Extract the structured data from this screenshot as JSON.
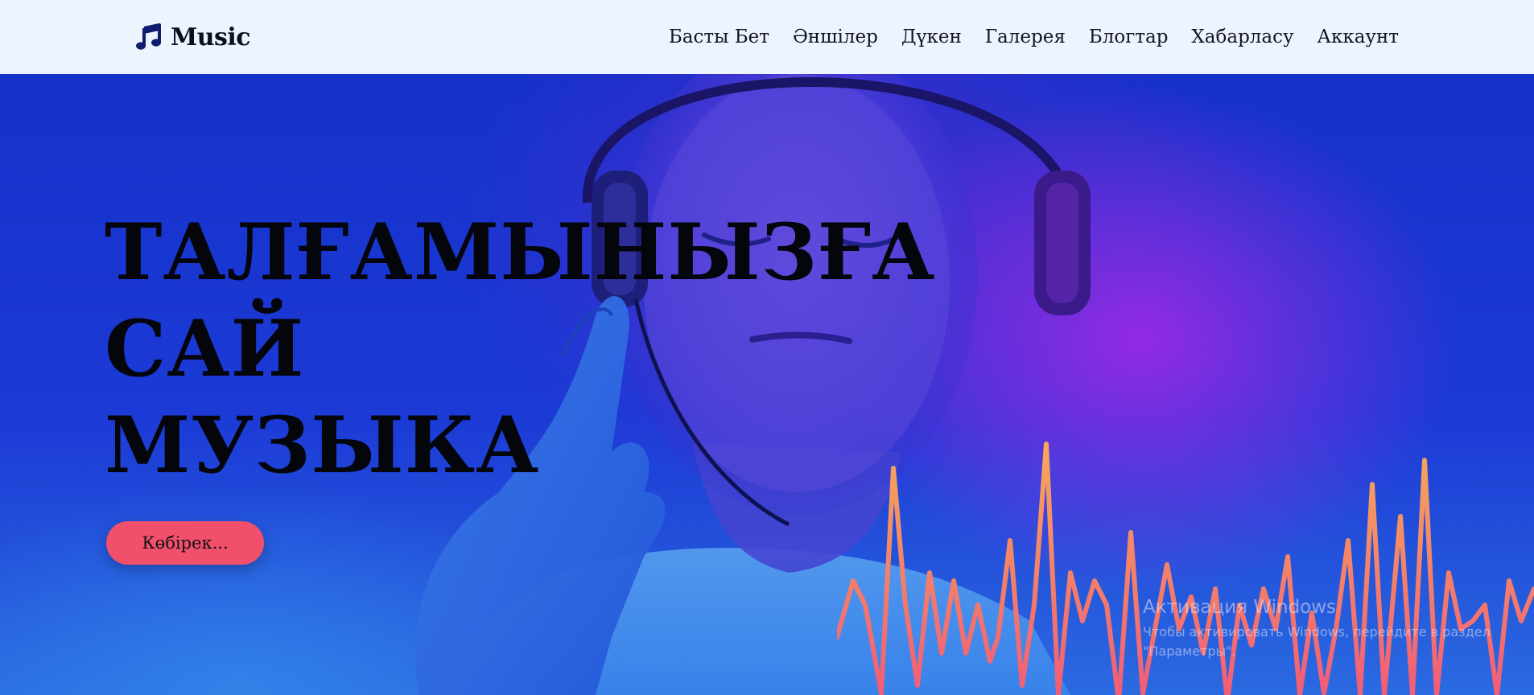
{
  "navbar": {
    "brand": {
      "name": "Music",
      "icon": "music-note-icon"
    },
    "links": [
      {
        "label": "Басты Бет"
      },
      {
        "label": "Әншілер"
      },
      {
        "label": "Дүкен"
      },
      {
        "label": "Галерея"
      },
      {
        "label": "Блогтар"
      },
      {
        "label": "Хабарласу"
      },
      {
        "label": "Аккаунт"
      }
    ]
  },
  "hero": {
    "title_lines": [
      "ТАЛҒАМЫНЫЗҒА",
      "САЙ",
      "МУЗЫКА"
    ],
    "button_label": "Көбірек...",
    "colors": {
      "background": "#1431c9",
      "accent_purple": "#a828e6",
      "button": "#f2506a",
      "waveform_top": "#f6a85a",
      "waveform_bottom": "#f25a78"
    }
  },
  "windows_activation": {
    "title": "Активация Windows",
    "text": "Чтобы активировать Windows, перейдите в раздел \"Параметры\"."
  }
}
